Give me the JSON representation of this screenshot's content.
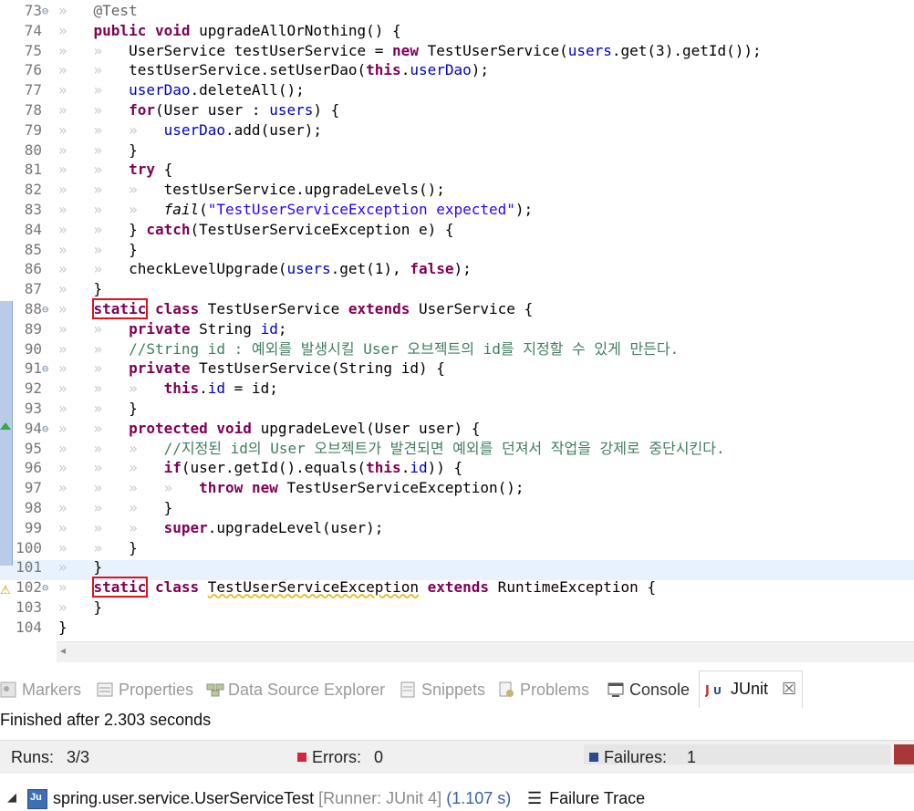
{
  "editor": {
    "lines": [
      {
        "n": "73",
        "fold": "⊖",
        "html": "<span class='ws'>»   </span><span class='ann'>@Test</span>"
      },
      {
        "n": "74",
        "fold": "",
        "html": "<span class='ws'>»   </span><span class='kw'>public</span> <span class='kw'>void</span> upgradeAllOrNothing() {"
      },
      {
        "n": "75",
        "fold": "",
        "html": "<span class='ws'>»   »   </span>UserService testUserService = <span class='kw'>new</span> TestUserService(<span class='fld'>users</span>.get(3).getId());"
      },
      {
        "n": "76",
        "fold": "",
        "html": "<span class='ws'>»   »   </span>testUserService.setUserDao(<span class='kw'>this</span>.<span class='fld'>userDao</span>);"
      },
      {
        "n": "77",
        "fold": "",
        "html": "<span class='ws'>»   »   </span><span class='fld'>userDao</span>.deleteAll();"
      },
      {
        "n": "78",
        "fold": "",
        "html": "<span class='ws'>»   »   </span><span class='kw'>for</span>(User user : <span class='fld'>users</span>) {"
      },
      {
        "n": "79",
        "fold": "",
        "html": "<span class='ws'>»   »   »   </span><span class='fld'>userDao</span>.add(user);"
      },
      {
        "n": "80",
        "fold": "",
        "html": "<span class='ws'>»   »   </span>}"
      },
      {
        "n": "81",
        "fold": "",
        "html": "<span class='ws'>»   »   </span><span class='kw'>try</span> {"
      },
      {
        "n": "82",
        "fold": "",
        "html": "<span class='ws'>»   »   »   </span>testUserService.upgradeLevels();"
      },
      {
        "n": "83",
        "fold": "",
        "html": "<span class='ws'>»   »   »   </span><span class='it'>fail</span>(<span class='str'>\"TestUserServiceException expected\"</span>);"
      },
      {
        "n": "84",
        "fold": "",
        "html": "<span class='ws'>»   »   </span>} <span class='kw'>catch</span>(TestUserServiceException e) {"
      },
      {
        "n": "85",
        "fold": "",
        "html": "<span class='ws'>»   »   </span>}"
      },
      {
        "n": "86",
        "fold": "",
        "html": "<span class='ws'>»   »   </span>checkLevelUpgrade(<span class='fld'>users</span>.get(1), <span class='kw'>false</span>);"
      },
      {
        "n": "87",
        "fold": "",
        "html": "<span class='ws'>»   </span>}"
      },
      {
        "n": "88",
        "fold": "⊖",
        "html": "<span class='ws'>»   </span><span class='kw hl'>static</span> <span class='kw'>class</span> TestUserService <span class='kw'>extends</span> UserService {"
      },
      {
        "n": "89",
        "fold": "",
        "html": "<span class='ws'>»   »   </span><span class='kw'>private</span> String <span class='fld'>id</span>;"
      },
      {
        "n": "90",
        "fold": "",
        "html": "<span class='ws'>»   »   </span><span class='cm'>//String id : 예외를 발생시킬 User 오브젝트의 id를 지정할 수 있게 만든다.</span>"
      },
      {
        "n": "91",
        "fold": "⊖",
        "html": "<span class='ws'>»   »   </span><span class='kw'>private</span> TestUserService(String id) {"
      },
      {
        "n": "92",
        "fold": "",
        "html": "<span class='ws'>»   »   »   </span><span class='kw'>this</span>.<span class='fld'>id</span> = id;"
      },
      {
        "n": "93",
        "fold": "",
        "html": "<span class='ws'>»   »   </span>}"
      },
      {
        "n": "94",
        "fold": "⊖",
        "html": "<span class='ws'>»   »   </span><span class='kw'>protected</span> <span class='kw'>void</span> upgradeLevel(User user) {"
      },
      {
        "n": "95",
        "fold": "",
        "html": "<span class='ws'>»   »   »   </span><span class='cm'>//지정된 id의 User 오브젝트가 발견되면 예외를 던져서 작업을 강제로 중단시킨다.</span>"
      },
      {
        "n": "96",
        "fold": "",
        "html": "<span class='ws'>»   »   »   </span><span class='kw'>if</span>(user.getId().equals(<span class='kw'>this</span>.<span class='fld'>id</span>)) {"
      },
      {
        "n": "97",
        "fold": "",
        "html": "<span class='ws'>»   »   »   »   </span><span class='kw'>throw</span> <span class='kw'>new</span> TestUserServiceException();"
      },
      {
        "n": "98",
        "fold": "",
        "html": "<span class='ws'>»   »   »   </span>}"
      },
      {
        "n": "99",
        "fold": "",
        "html": "<span class='ws'>»   »   »   </span><span class='kw'>super</span>.upgradeLevel(user);"
      },
      {
        "n": "100",
        "fold": "",
        "html": "<span class='ws'>»   »   </span>}"
      },
      {
        "n": "101",
        "fold": "",
        "html": "<span class='ws'>»   </span>}"
      },
      {
        "n": "102",
        "fold": "⊖",
        "html": "<span class='ws'>»   </span><span class='kw hl'>static</span> <span class='kw'>class</span> <span class='squig'>TestUserServiceException</span> <span class='kw'>extends</span> RuntimeException {"
      },
      {
        "n": "103",
        "fold": "",
        "html": "<span class='ws'>»   </span>}"
      },
      {
        "n": "104",
        "fold": "",
        "html": "}"
      }
    ]
  },
  "panel": {
    "tabs": [
      {
        "label": "Markers",
        "icon": "markers-icon"
      },
      {
        "label": "Properties",
        "icon": "properties-icon"
      },
      {
        "label": "Data Source Explorer",
        "icon": "data-source-icon"
      },
      {
        "label": "Snippets",
        "icon": "snippets-icon"
      },
      {
        "label": "Problems",
        "icon": "problems-icon"
      },
      {
        "label": "Console",
        "icon": "console-icon"
      },
      {
        "label": "JUnit",
        "icon": "junit-icon",
        "active": true
      }
    ],
    "status": "Finished after 2.303 seconds",
    "runs_label": "Runs:",
    "runs_value": "3/3",
    "errors_label": "Errors:",
    "errors_value": "0",
    "failures_label": "Failures:",
    "failures_value": "1",
    "colors": {
      "failure_bar": "#a83838",
      "error": "#d0283a"
    },
    "tree": {
      "label": "spring.user.service.UserServiceTest",
      "runner": "[Runner: JUnit 4]",
      "time": "(1.107 s)"
    },
    "failure_trace_label": "Failure Trace"
  }
}
